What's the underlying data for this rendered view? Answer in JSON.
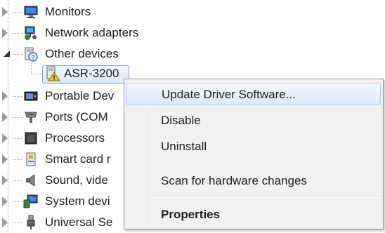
{
  "tree": {
    "items": [
      {
        "label": "Monitors",
        "icon": "monitor-icon",
        "state": "collapsed"
      },
      {
        "label": "Network adapters",
        "icon": "network-adapter-icon",
        "state": "collapsed"
      },
      {
        "label": "Other devices",
        "icon": "unknown-device-icon",
        "state": "expanded"
      },
      {
        "label": "ASR-3200",
        "icon": "warning-device-icon",
        "state": "selected"
      },
      {
        "label": "Portable Dev",
        "icon": "portable-device-icon",
        "state": "collapsed"
      },
      {
        "label": "Ports (COM",
        "icon": "port-icon",
        "state": "collapsed"
      },
      {
        "label": "Processors",
        "icon": "processor-icon",
        "state": "collapsed"
      },
      {
        "label": "Smart card r",
        "icon": "smart-card-icon",
        "state": "collapsed"
      },
      {
        "label": "Sound, vide",
        "icon": "speaker-icon",
        "state": "collapsed"
      },
      {
        "label": "System devi",
        "icon": "system-device-icon",
        "state": "collapsed"
      },
      {
        "label": "Universal Se",
        "icon": "usb-icon",
        "state": "collapsed"
      }
    ]
  },
  "context_menu": {
    "items": [
      {
        "label": "Update Driver Software...",
        "state": "hover"
      },
      {
        "label": "Disable"
      },
      {
        "label": "Uninstall"
      },
      {
        "label": "Scan for hardware changes"
      },
      {
        "label": "Properties",
        "style": "bold"
      }
    ]
  },
  "colors": {
    "selection_border": "#7da2ce",
    "menu_background": "#f1f1f1",
    "menu_hover_border": "#aeccf1"
  }
}
